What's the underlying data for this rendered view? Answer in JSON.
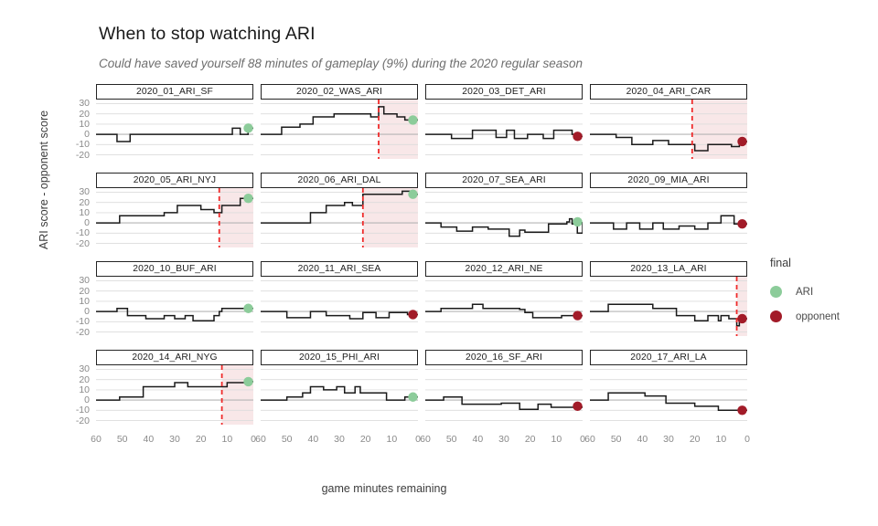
{
  "header": {
    "title": "When to stop watching ARI",
    "subtitle": "Could have saved yourself 88 minutes of gameplay (9%) during the 2020 regular season"
  },
  "legend": {
    "title": "final",
    "items": [
      {
        "label": "ARI",
        "color": "#8ccc9a"
      },
      {
        "label": "opponent",
        "color": "#a21b28"
      }
    ]
  },
  "chart_data": {
    "type": "line",
    "title": "When to stop watching ARI",
    "subtitle": "Could have saved yourself 88 minutes of gameplay (9%) during the 2020 regular season",
    "xlabel": "game minutes remaining",
    "ylabel": "ARI score - opponent score",
    "xlim": [
      60,
      0
    ],
    "ylim": [
      -24,
      34
    ],
    "x_ticks": [
      60,
      50,
      40,
      30,
      20,
      10,
      0
    ],
    "y_ticks": [
      30,
      20,
      10,
      0,
      -10,
      -20
    ],
    "x_reversed": true,
    "grid": "horizontal",
    "legend_position": "right",
    "facet_columns": 4,
    "facet_rows": 4,
    "line_color": "#1a1a1a",
    "cutoff_line_color": "#ef2b2b",
    "cutoff_shade_color": "#f6dfe0",
    "series_note": "step lines of score differential vs minutes remaining; dashed vertical line marks the moment outcome was decided; shaded region is the skippable gameplay",
    "panels": [
      {
        "title": "2020_01_ARI_SF",
        "final": "ARI",
        "final_value": 6,
        "cutoff": null,
        "points": [
          [
            60,
            0
          ],
          [
            54,
            0
          ],
          [
            52,
            -7
          ],
          [
            49,
            -7
          ],
          [
            47,
            0
          ],
          [
            12,
            0
          ],
          [
            10,
            0
          ],
          [
            8,
            6
          ],
          [
            6,
            6
          ],
          [
            5,
            0
          ],
          [
            3,
            0
          ],
          [
            2,
            6
          ],
          [
            0,
            6
          ]
        ]
      },
      {
        "title": "2020_02_WAS_ARI",
        "final": "ARI",
        "final_value": 14,
        "cutoff": 15,
        "points": [
          [
            60,
            0
          ],
          [
            54,
            0
          ],
          [
            52,
            7
          ],
          [
            47,
            7
          ],
          [
            45,
            10
          ],
          [
            42,
            10
          ],
          [
            40,
            17
          ],
          [
            34,
            17
          ],
          [
            32,
            20
          ],
          [
            23,
            20
          ],
          [
            21,
            20
          ],
          [
            18,
            17
          ],
          [
            16,
            17
          ],
          [
            15,
            27
          ],
          [
            13,
            20
          ],
          [
            10,
            20
          ],
          [
            8,
            17
          ],
          [
            5,
            14
          ],
          [
            0,
            14
          ]
        ]
      },
      {
        "title": "2020_03_DET_ARI",
        "final": "opponent",
        "final_value": -2,
        "cutoff": null,
        "points": [
          [
            60,
            0
          ],
          [
            52,
            0
          ],
          [
            50,
            -4
          ],
          [
            44,
            -4
          ],
          [
            42,
            4
          ],
          [
            35,
            4
          ],
          [
            33,
            -3
          ],
          [
            30,
            -3
          ],
          [
            29,
            4
          ],
          [
            27,
            4
          ],
          [
            26,
            -4
          ],
          [
            22,
            -4
          ],
          [
            21,
            0
          ],
          [
            16,
            0
          ],
          [
            15,
            -4
          ],
          [
            12,
            -4
          ],
          [
            11,
            4
          ],
          [
            6,
            4
          ],
          [
            4,
            0
          ],
          [
            2,
            -2
          ],
          [
            0,
            -2
          ]
        ]
      },
      {
        "title": "2020_04_ARI_CAR",
        "final": "opponent",
        "final_value": -7,
        "cutoff": 21,
        "points": [
          [
            60,
            0
          ],
          [
            52,
            0
          ],
          [
            50,
            -3
          ],
          [
            46,
            -3
          ],
          [
            44,
            -10
          ],
          [
            38,
            -10
          ],
          [
            36,
            -6
          ],
          [
            32,
            -6
          ],
          [
            30,
            -10
          ],
          [
            23,
            -10
          ],
          [
            21,
            -10
          ],
          [
            20,
            -16
          ],
          [
            17,
            -16
          ],
          [
            15,
            -10
          ],
          [
            8,
            -10
          ],
          [
            6,
            -12
          ],
          [
            4,
            -12
          ],
          [
            3,
            -7
          ],
          [
            0,
            -7
          ]
        ]
      },
      {
        "title": "2020_05_ARI_NYJ",
        "final": "ARI",
        "final_value": 24,
        "cutoff": 13,
        "points": [
          [
            60,
            0
          ],
          [
            53,
            0
          ],
          [
            51,
            7
          ],
          [
            44,
            7
          ],
          [
            42,
            7
          ],
          [
            36,
            7
          ],
          [
            34,
            10
          ],
          [
            31,
            10
          ],
          [
            29,
            17
          ],
          [
            22,
            17
          ],
          [
            20,
            13
          ],
          [
            17,
            13
          ],
          [
            15,
            10
          ],
          [
            13,
            10
          ],
          [
            12,
            17
          ],
          [
            7,
            17
          ],
          [
            5,
            24
          ],
          [
            0,
            24
          ]
        ]
      },
      {
        "title": "2020_06_ARI_DAL",
        "final": "ARI",
        "final_value": 28,
        "cutoff": 21,
        "points": [
          [
            60,
            0
          ],
          [
            43,
            0
          ],
          [
            41,
            10
          ],
          [
            37,
            10
          ],
          [
            35,
            17
          ],
          [
            30,
            17
          ],
          [
            28,
            20
          ],
          [
            25,
            17
          ],
          [
            23,
            17
          ],
          [
            21,
            28
          ],
          [
            8,
            28
          ],
          [
            6,
            31
          ],
          [
            3,
            31
          ],
          [
            2,
            28
          ],
          [
            0,
            28
          ]
        ]
      },
      {
        "title": "2020_07_SEA_ARI",
        "final": "ARI",
        "final_value": 1,
        "cutoff": null,
        "points": [
          [
            60,
            0
          ],
          [
            56,
            0
          ],
          [
            54,
            -4
          ],
          [
            50,
            -4
          ],
          [
            48,
            -8
          ],
          [
            44,
            -8
          ],
          [
            42,
            -4
          ],
          [
            38,
            -4
          ],
          [
            36,
            -6
          ],
          [
            30,
            -6
          ],
          [
            28,
            -13
          ],
          [
            25,
            -13
          ],
          [
            24,
            -7
          ],
          [
            22,
            -9
          ],
          [
            14,
            -9
          ],
          [
            13,
            -1
          ],
          [
            8,
            -1
          ],
          [
            6,
            1
          ],
          [
            5,
            4
          ],
          [
            4,
            -1
          ],
          [
            3,
            3
          ],
          [
            2,
            -10
          ],
          [
            1,
            -10
          ],
          [
            0,
            1
          ]
        ]
      },
      {
        "title": "2020_09_MIA_ARI",
        "final": "opponent",
        "final_value": -1,
        "cutoff": null,
        "points": [
          [
            60,
            0
          ],
          [
            53,
            0
          ],
          [
            51,
            -6
          ],
          [
            48,
            -6
          ],
          [
            46,
            0
          ],
          [
            43,
            0
          ],
          [
            41,
            -6
          ],
          [
            38,
            -6
          ],
          [
            36,
            0
          ],
          [
            33,
            0
          ],
          [
            32,
            -6
          ],
          [
            28,
            -6
          ],
          [
            26,
            -3
          ],
          [
            22,
            -3
          ],
          [
            20,
            -6
          ],
          [
            17,
            -6
          ],
          [
            15,
            0
          ],
          [
            11,
            0
          ],
          [
            10,
            7
          ],
          [
            6,
            7
          ],
          [
            5,
            -1
          ],
          [
            0,
            -1
          ]
        ]
      },
      {
        "title": "2020_10_BUF_ARI",
        "final": "ARI",
        "final_value": 3,
        "cutoff": null,
        "points": [
          [
            60,
            0
          ],
          [
            53,
            0
          ],
          [
            52,
            3
          ],
          [
            49,
            3
          ],
          [
            48,
            -4
          ],
          [
            42,
            -4
          ],
          [
            41,
            -7
          ],
          [
            35,
            -7
          ],
          [
            34,
            -4
          ],
          [
            31,
            -4
          ],
          [
            30,
            -7
          ],
          [
            27,
            -7
          ],
          [
            26,
            -4
          ],
          [
            24,
            -4
          ],
          [
            23,
            -9
          ],
          [
            17,
            -9
          ],
          [
            15,
            -4
          ],
          [
            13,
            0
          ],
          [
            12,
            3
          ],
          [
            0,
            3
          ]
        ]
      },
      {
        "title": "2020_11_ARI_SEA",
        "final": "opponent",
        "final_value": -3,
        "cutoff": null,
        "points": [
          [
            60,
            0
          ],
          [
            52,
            0
          ],
          [
            50,
            -6
          ],
          [
            43,
            -6
          ],
          [
            41,
            0
          ],
          [
            37,
            0
          ],
          [
            35,
            -4
          ],
          [
            28,
            -4
          ],
          [
            26,
            -7
          ],
          [
            22,
            -7
          ],
          [
            21,
            -1
          ],
          [
            18,
            -1
          ],
          [
            16,
            -6
          ],
          [
            12,
            -6
          ],
          [
            11,
            -1
          ],
          [
            6,
            -1
          ],
          [
            4,
            -3
          ],
          [
            0,
            -3
          ]
        ]
      },
      {
        "title": "2020_12_ARI_NE",
        "final": "opponent",
        "final_value": -4,
        "cutoff": null,
        "points": [
          [
            60,
            0
          ],
          [
            56,
            0
          ],
          [
            54,
            3
          ],
          [
            44,
            3
          ],
          [
            42,
            7
          ],
          [
            40,
            7
          ],
          [
            38,
            3
          ],
          [
            24,
            2
          ],
          [
            22,
            -1
          ],
          [
            20,
            -1
          ],
          [
            19,
            -6
          ],
          [
            10,
            -6
          ],
          [
            8,
            -4
          ],
          [
            0,
            -4
          ]
        ]
      },
      {
        "title": "2020_13_LA_ARI",
        "final": "opponent",
        "final_value": -7,
        "cutoff": 4,
        "points": [
          [
            60,
            0
          ],
          [
            55,
            0
          ],
          [
            53,
            7
          ],
          [
            38,
            7
          ],
          [
            36,
            3
          ],
          [
            29,
            3
          ],
          [
            27,
            -4
          ],
          [
            22,
            -4
          ],
          [
            20,
            -9
          ],
          [
            16,
            -9
          ],
          [
            15,
            -4
          ],
          [
            12,
            -4
          ],
          [
            11,
            -9
          ],
          [
            10,
            -4
          ],
          [
            8,
            -4
          ],
          [
            7,
            -7
          ],
          [
            5,
            -7
          ],
          [
            4,
            -14
          ],
          [
            3,
            -7
          ],
          [
            0,
            -7
          ]
        ]
      },
      {
        "title": "2020_14_ARI_NYG",
        "final": "ARI",
        "final_value": 18,
        "cutoff": 12,
        "points": [
          [
            60,
            0
          ],
          [
            53,
            0
          ],
          [
            51,
            3
          ],
          [
            44,
            3
          ],
          [
            42,
            13
          ],
          [
            32,
            13
          ],
          [
            30,
            17
          ],
          [
            27,
            17
          ],
          [
            25,
            13
          ],
          [
            13,
            13
          ],
          [
            12,
            13
          ],
          [
            10,
            17
          ],
          [
            5,
            17
          ],
          [
            3,
            18
          ],
          [
            0,
            18
          ]
        ]
      },
      {
        "title": "2020_15_PHI_ARI",
        "final": "ARI",
        "final_value": 3,
        "cutoff": null,
        "points": [
          [
            60,
            0
          ],
          [
            52,
            0
          ],
          [
            50,
            3
          ],
          [
            46,
            3
          ],
          [
            44,
            7
          ],
          [
            42,
            7
          ],
          [
            41,
            13
          ],
          [
            38,
            13
          ],
          [
            36,
            10
          ],
          [
            32,
            10
          ],
          [
            31,
            13
          ],
          [
            29,
            13
          ],
          [
            28,
            7
          ],
          [
            25,
            7
          ],
          [
            24,
            13
          ],
          [
            22,
            7
          ],
          [
            14,
            7
          ],
          [
            12,
            0
          ],
          [
            7,
            0
          ],
          [
            5,
            3
          ],
          [
            0,
            3
          ]
        ]
      },
      {
        "title": "2020_16_SF_ARI",
        "final": "opponent",
        "final_value": -6,
        "cutoff": null,
        "points": [
          [
            60,
            0
          ],
          [
            55,
            0
          ],
          [
            53,
            3
          ],
          [
            48,
            3
          ],
          [
            46,
            -4
          ],
          [
            33,
            -4
          ],
          [
            31,
            -3
          ],
          [
            26,
            -3
          ],
          [
            24,
            -9
          ],
          [
            19,
            -9
          ],
          [
            17,
            -4
          ],
          [
            14,
            -4
          ],
          [
            12,
            -7
          ],
          [
            2,
            -7
          ],
          [
            0,
            -6
          ]
        ]
      },
      {
        "title": "2020_17_ARI_LA",
        "final": "opponent",
        "final_value": -10,
        "cutoff": null,
        "points": [
          [
            60,
            0
          ],
          [
            55,
            0
          ],
          [
            53,
            7
          ],
          [
            41,
            7
          ],
          [
            39,
            4
          ],
          [
            33,
            4
          ],
          [
            31,
            -3
          ],
          [
            22,
            -3
          ],
          [
            20,
            -6
          ],
          [
            13,
            -6
          ],
          [
            11,
            -10
          ],
          [
            0,
            -10
          ]
        ]
      }
    ]
  }
}
